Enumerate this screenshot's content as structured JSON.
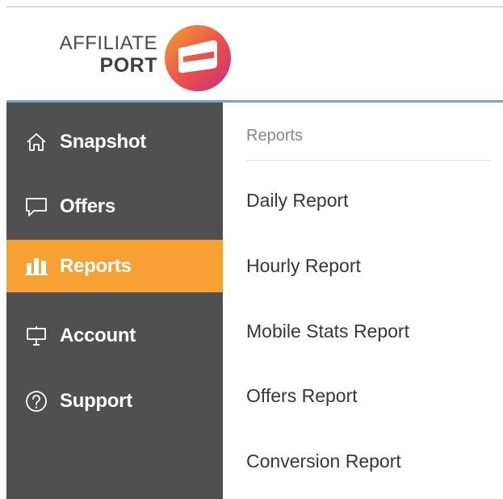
{
  "header": {
    "logo": {
      "line1": "AFFILIATE",
      "line2": "PORT",
      "mark_colors": [
        "#f3a231",
        "#ea4f4b",
        "#c7307d"
      ]
    }
  },
  "sidebar": {
    "background": "#505050",
    "active_color": "#f7a135",
    "items": [
      {
        "label": "Snapshot",
        "icon": "home-icon",
        "active": false
      },
      {
        "label": "Offers",
        "icon": "speech-bubble-icon",
        "active": false
      },
      {
        "label": "Reports",
        "icon": "bar-chart-icon",
        "active": true
      },
      {
        "label": "Account",
        "icon": "easel-icon",
        "active": false
      },
      {
        "label": "Support",
        "icon": "help-circle-icon",
        "active": false
      }
    ]
  },
  "main": {
    "section_title": "Reports",
    "links": [
      {
        "label": "Daily Report"
      },
      {
        "label": "Hourly Report"
      },
      {
        "label": "Mobile Stats Report"
      },
      {
        "label": "Offers Report"
      },
      {
        "label": "Conversion Report"
      }
    ]
  }
}
